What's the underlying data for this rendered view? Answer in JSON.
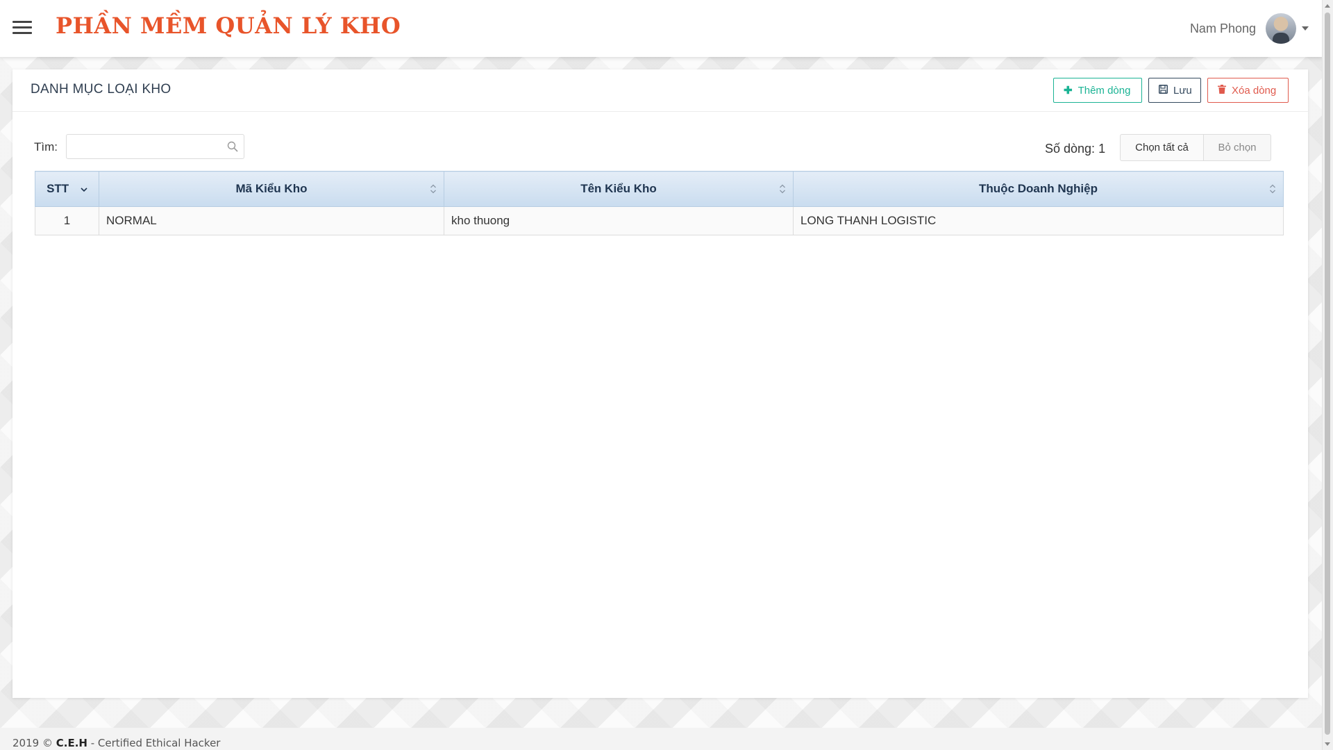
{
  "header": {
    "app_title": "PHẦN MỀM QUẢN LÝ KHO",
    "user_name": "Nam Phong"
  },
  "panel": {
    "title": "DANH MỤC LOẠI KHO",
    "buttons": {
      "add": "Thêm dòng",
      "save": "Lưu",
      "delete": "Xóa dòng"
    },
    "search": {
      "label": "Tìm:",
      "value": "",
      "placeholder": ""
    },
    "row_count": "Số dòng: 1",
    "select_all": "Chọn tất cả",
    "deselect": "Bỏ chọn"
  },
  "table": {
    "columns": [
      "STT",
      "Mã Kiểu Kho",
      "Tên Kiểu Kho",
      "Thuộc Doanh Nghiệp"
    ],
    "rows": [
      [
        "1",
        "NORMAL",
        "kho thuong",
        "LONG THANH LOGISTIC"
      ]
    ]
  },
  "footer": {
    "year": "2019 ©",
    "brand": "C.E.H",
    "rest": " - Certified Ethical Hacker"
  },
  "colors": {
    "title_red": "#e8542a",
    "add_green": "#1ab394",
    "save_dark": "#34495e",
    "delete_red": "#e05a4d",
    "header_blue": "#c9dcef"
  },
  "icons": {
    "menu": "hamburger-icon",
    "search": "search-icon",
    "add": "plus-icon",
    "save": "floppy-disk-icon",
    "delete": "trash-icon"
  }
}
